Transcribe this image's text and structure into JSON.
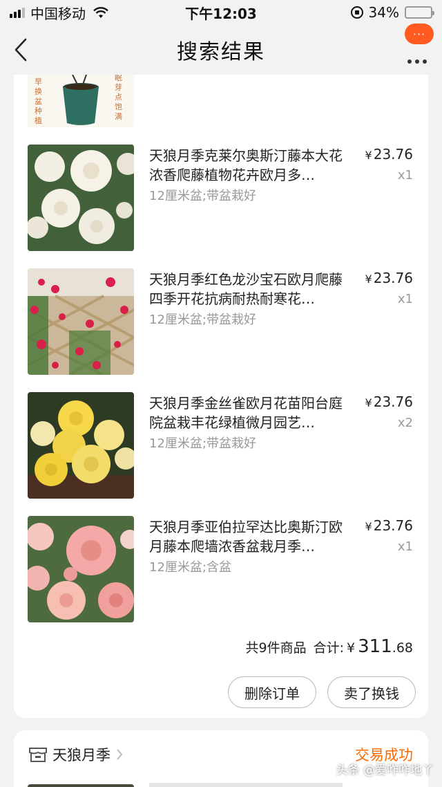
{
  "status_bar": {
    "carrier": "中国移动",
    "time": "下午12:03",
    "battery": "34%",
    "battery_level": 0.34
  },
  "nav": {
    "title": "搜索结果",
    "badge": "···"
  },
  "partial_item": {
    "left_text": "早换盆种植",
    "left_text_top": "?",
    "right_text": "眠芽点饱满"
  },
  "items": [
    {
      "title": "天狼月季克莱尔奥斯汀藤本大花浓香爬藤植物花卉欧月多…",
      "spec": "12厘米盆;带盆栽好",
      "price_symbol": "¥",
      "price": "23.76",
      "qty": "x1",
      "flower_color": "#f3efe4"
    },
    {
      "title": "天狼月季红色龙沙宝石欧月爬藤四季开花抗病耐热耐寒花…",
      "spec": "12厘米盆;带盆栽好",
      "price_symbol": "¥",
      "price": "23.76",
      "qty": "x1",
      "flower_color": "#d8204a"
    },
    {
      "title": "天狼月季金丝雀欧月花苗阳台庭院盆栽丰花绿植微月园艺…",
      "spec": "12厘米盆;带盆栽好",
      "price_symbol": "¥",
      "price": "23.76",
      "qty": "x2",
      "flower_color": "#f6d84a"
    },
    {
      "title": "天狼月季亚伯拉罕达比奥斯汀欧月藤本爬墙浓香盆栽月季…",
      "spec": "12厘米盆;含盆",
      "price_symbol": "¥",
      "price": "23.76",
      "qty": "x1",
      "flower_color": "#f4a9a8"
    }
  ],
  "summary": {
    "count_text": "共9件商品",
    "total_label": "合计:",
    "currency": "¥",
    "total_int": "311",
    "total_dec": ".68"
  },
  "actions": {
    "delete": "删除订单",
    "sell": "卖了换钱"
  },
  "next_order": {
    "shop_name": "天狼月季",
    "status": "交易成功"
  },
  "watermark": "头条 @爱咋咋地丫",
  "colors": {
    "accent": "#ff6a00",
    "badge": "#ff5a1f"
  }
}
